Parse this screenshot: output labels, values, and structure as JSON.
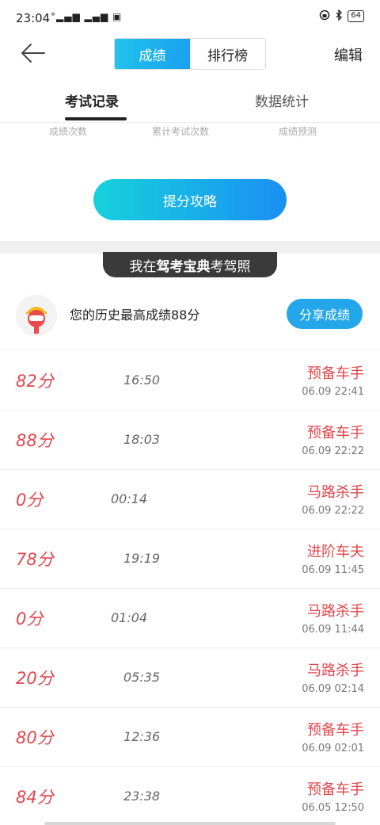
{
  "status_bar": {
    "time": "23:04",
    "signal": "°▂▄▆ ▂▄▆ ▣",
    "battery": "64"
  },
  "nav": {
    "tabs": [
      "成绩",
      "排行榜"
    ],
    "active_tab": "成绩",
    "edit_label": "编辑"
  },
  "sub_tabs": {
    "record": "考试记录",
    "stats": "数据统计"
  },
  "summary_labels": [
    "成绩次数",
    "累计考试次数",
    "成绩预测"
  ],
  "tips_button": "提分攻略",
  "brand_banner": {
    "prefix": "我在",
    "brand": "驾考宝典",
    "suffix": "考驾照"
  },
  "best": {
    "text": "您的历史最高成绩88分",
    "share_label": "分享成绩"
  },
  "records": [
    {
      "score": "82分",
      "duration": "16:50",
      "title": "预备车手",
      "time": "06.09  22:41"
    },
    {
      "score": "88分",
      "duration": "18:03",
      "title": "预备车手",
      "time": "06.09  22:22"
    },
    {
      "score": "0分",
      "duration": "00:14",
      "title": "马路杀手",
      "time": "06.09  22:22"
    },
    {
      "score": "78分",
      "duration": "19:19",
      "title": "进阶车夫",
      "time": "06.09  11:45"
    },
    {
      "score": "0分",
      "duration": "01:04",
      "title": "马路杀手",
      "time": "06.09  11:44"
    },
    {
      "score": "20分",
      "duration": "05:35",
      "title": "马路杀手",
      "time": "06.09  02:14"
    },
    {
      "score": "80分",
      "duration": "12:36",
      "title": "预备车手",
      "time": "06.09  02:01"
    },
    {
      "score": "84分",
      "duration": "23:38",
      "title": "预备车手",
      "time": "06.05  12:50"
    }
  ],
  "colors": {
    "accent": "#1aa0f0",
    "score_red": "#e0474c",
    "banner_dark": "#3a3a3a"
  }
}
